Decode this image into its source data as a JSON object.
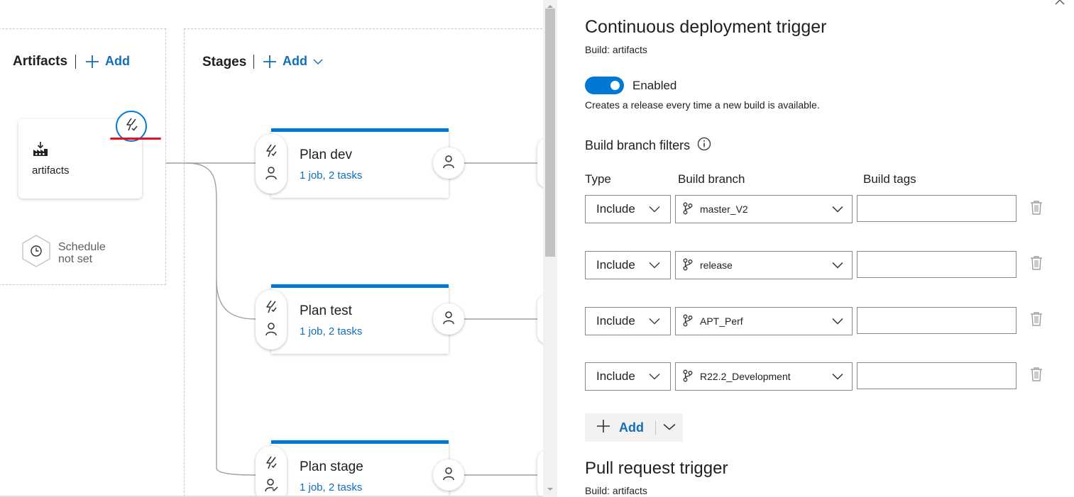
{
  "canvas": {
    "artifacts": {
      "title": "Artifacts",
      "add_label": "Add",
      "card_label": "artifacts",
      "schedule_line1": "Schedule",
      "schedule_line2": "not set"
    },
    "stages": {
      "title": "Stages",
      "add_label": "Add",
      "items": [
        {
          "name": "Plan dev",
          "summary": "1 job, 2 tasks"
        },
        {
          "name": "Plan test",
          "summary": "1 job, 2 tasks"
        },
        {
          "name": "Plan stage",
          "summary": "1 job, 2 tasks"
        }
      ]
    }
  },
  "panel": {
    "title": "Continuous deployment trigger",
    "subtitle": "Build: artifacts",
    "toggle_label": "Enabled",
    "toggle_on": true,
    "description": "Creates a release every time a new build is available.",
    "filters_title": "Build branch filters",
    "columns": {
      "type": "Type",
      "branch": "Build branch",
      "tags": "Build tags"
    },
    "filters": [
      {
        "type": "Include",
        "branch": "master_V2",
        "tags": ""
      },
      {
        "type": "Include",
        "branch": "release",
        "tags": ""
      },
      {
        "type": "Include",
        "branch": "APT_Perf",
        "tags": ""
      },
      {
        "type": "Include",
        "branch": "R22.2_Development",
        "tags": ""
      }
    ],
    "add_label": "Add",
    "pr_title": "Pull request trigger",
    "pr_subtitle": "Build: artifacts"
  },
  "colors": {
    "accent": "#0078d4",
    "link": "#106ebe",
    "annotation_red": "#e81123"
  },
  "icons": {
    "add": "plus-icon",
    "trigger": "lightning-icon",
    "approver": "person-icon",
    "artifact": "build-factory-icon",
    "schedule": "clock-icon",
    "branch": "branch-icon",
    "delete": "trash-icon",
    "info": "info-icon",
    "dropdown": "chevron-down-icon"
  }
}
